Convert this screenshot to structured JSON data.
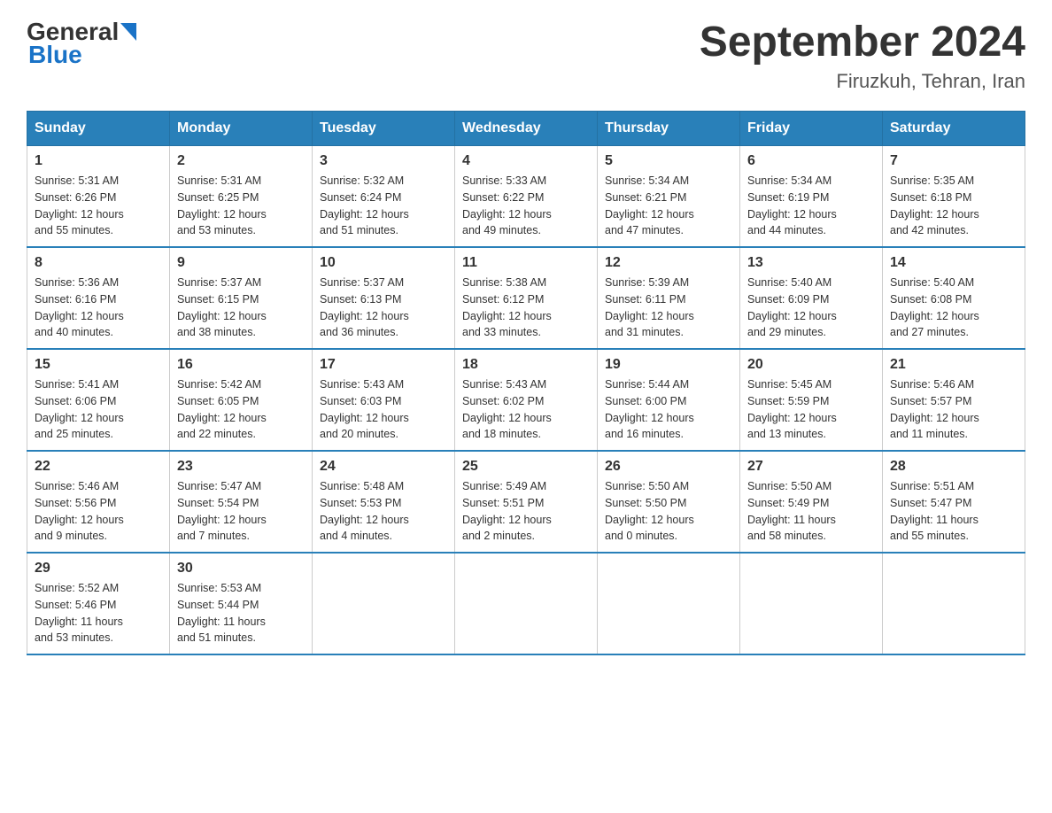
{
  "header": {
    "logo_general": "General",
    "logo_blue": "Blue",
    "title": "September 2024",
    "subtitle": "Firuzkuh, Tehran, Iran"
  },
  "weekdays": [
    "Sunday",
    "Monday",
    "Tuesday",
    "Wednesday",
    "Thursday",
    "Friday",
    "Saturday"
  ],
  "weeks": [
    [
      {
        "day": "1",
        "sunrise": "5:31 AM",
        "sunset": "6:26 PM",
        "daylight": "12 hours and 55 minutes."
      },
      {
        "day": "2",
        "sunrise": "5:31 AM",
        "sunset": "6:25 PM",
        "daylight": "12 hours and 53 minutes."
      },
      {
        "day": "3",
        "sunrise": "5:32 AM",
        "sunset": "6:24 PM",
        "daylight": "12 hours and 51 minutes."
      },
      {
        "day": "4",
        "sunrise": "5:33 AM",
        "sunset": "6:22 PM",
        "daylight": "12 hours and 49 minutes."
      },
      {
        "day": "5",
        "sunrise": "5:34 AM",
        "sunset": "6:21 PM",
        "daylight": "12 hours and 47 minutes."
      },
      {
        "day": "6",
        "sunrise": "5:34 AM",
        "sunset": "6:19 PM",
        "daylight": "12 hours and 44 minutes."
      },
      {
        "day": "7",
        "sunrise": "5:35 AM",
        "sunset": "6:18 PM",
        "daylight": "12 hours and 42 minutes."
      }
    ],
    [
      {
        "day": "8",
        "sunrise": "5:36 AM",
        "sunset": "6:16 PM",
        "daylight": "12 hours and 40 minutes."
      },
      {
        "day": "9",
        "sunrise": "5:37 AM",
        "sunset": "6:15 PM",
        "daylight": "12 hours and 38 minutes."
      },
      {
        "day": "10",
        "sunrise": "5:37 AM",
        "sunset": "6:13 PM",
        "daylight": "12 hours and 36 minutes."
      },
      {
        "day": "11",
        "sunrise": "5:38 AM",
        "sunset": "6:12 PM",
        "daylight": "12 hours and 33 minutes."
      },
      {
        "day": "12",
        "sunrise": "5:39 AM",
        "sunset": "6:11 PM",
        "daylight": "12 hours and 31 minutes."
      },
      {
        "day": "13",
        "sunrise": "5:40 AM",
        "sunset": "6:09 PM",
        "daylight": "12 hours and 29 minutes."
      },
      {
        "day": "14",
        "sunrise": "5:40 AM",
        "sunset": "6:08 PM",
        "daylight": "12 hours and 27 minutes."
      }
    ],
    [
      {
        "day": "15",
        "sunrise": "5:41 AM",
        "sunset": "6:06 PM",
        "daylight": "12 hours and 25 minutes."
      },
      {
        "day": "16",
        "sunrise": "5:42 AM",
        "sunset": "6:05 PM",
        "daylight": "12 hours and 22 minutes."
      },
      {
        "day": "17",
        "sunrise": "5:43 AM",
        "sunset": "6:03 PM",
        "daylight": "12 hours and 20 minutes."
      },
      {
        "day": "18",
        "sunrise": "5:43 AM",
        "sunset": "6:02 PM",
        "daylight": "12 hours and 18 minutes."
      },
      {
        "day": "19",
        "sunrise": "5:44 AM",
        "sunset": "6:00 PM",
        "daylight": "12 hours and 16 minutes."
      },
      {
        "day": "20",
        "sunrise": "5:45 AM",
        "sunset": "5:59 PM",
        "daylight": "12 hours and 13 minutes."
      },
      {
        "day": "21",
        "sunrise": "5:46 AM",
        "sunset": "5:57 PM",
        "daylight": "12 hours and 11 minutes."
      }
    ],
    [
      {
        "day": "22",
        "sunrise": "5:46 AM",
        "sunset": "5:56 PM",
        "daylight": "12 hours and 9 minutes."
      },
      {
        "day": "23",
        "sunrise": "5:47 AM",
        "sunset": "5:54 PM",
        "daylight": "12 hours and 7 minutes."
      },
      {
        "day": "24",
        "sunrise": "5:48 AM",
        "sunset": "5:53 PM",
        "daylight": "12 hours and 4 minutes."
      },
      {
        "day": "25",
        "sunrise": "5:49 AM",
        "sunset": "5:51 PM",
        "daylight": "12 hours and 2 minutes."
      },
      {
        "day": "26",
        "sunrise": "5:50 AM",
        "sunset": "5:50 PM",
        "daylight": "12 hours and 0 minutes."
      },
      {
        "day": "27",
        "sunrise": "5:50 AM",
        "sunset": "5:49 PM",
        "daylight": "11 hours and 58 minutes."
      },
      {
        "day": "28",
        "sunrise": "5:51 AM",
        "sunset": "5:47 PM",
        "daylight": "11 hours and 55 minutes."
      }
    ],
    [
      {
        "day": "29",
        "sunrise": "5:52 AM",
        "sunset": "5:46 PM",
        "daylight": "11 hours and 53 minutes."
      },
      {
        "day": "30",
        "sunrise": "5:53 AM",
        "sunset": "5:44 PM",
        "daylight": "11 hours and 51 minutes."
      },
      null,
      null,
      null,
      null,
      null
    ]
  ],
  "labels": {
    "sunrise": "Sunrise:",
    "sunset": "Sunset:",
    "daylight": "Daylight:"
  }
}
